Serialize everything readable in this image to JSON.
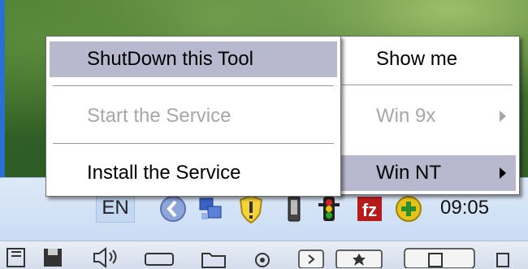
{
  "main_menu": {
    "items": [
      {
        "label": "ShutDown this Tool",
        "enabled": true,
        "highlighted": true
      },
      {
        "label": "Start the Service",
        "enabled": false
      },
      {
        "label": "Install the Service",
        "enabled": true
      }
    ]
  },
  "sub_menu": {
    "items": [
      {
        "label": "Show me",
        "enabled": true
      },
      {
        "label": "Win 9x",
        "enabled": false,
        "has_submenu": true
      },
      {
        "label": "Win NT",
        "enabled": true,
        "has_submenu": true,
        "highlighted": true
      }
    ]
  },
  "tray": {
    "language": "EN",
    "clock": "09:05",
    "icons": [
      "chevron-left-icon",
      "network-icon",
      "shield-warning-icon",
      "device-icon",
      "traffic-light-icon",
      "filezilla-icon",
      "plus-icon"
    ]
  },
  "colors": {
    "menu_highlight": "#b8b8cf",
    "disabled_text": "#a7a7a7",
    "taskbar": "#c9dbf3"
  }
}
